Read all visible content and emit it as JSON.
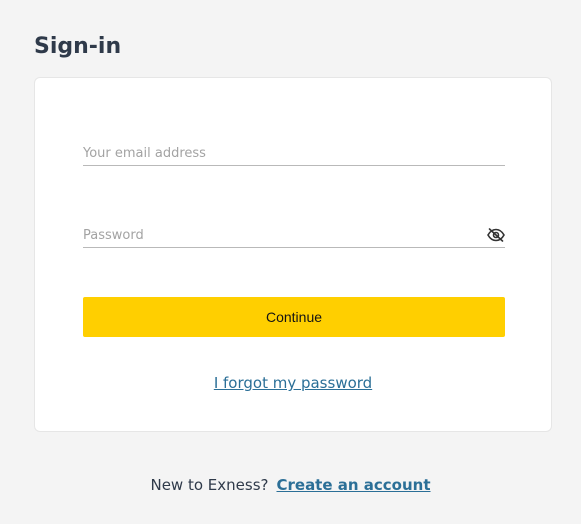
{
  "page": {
    "title": "Sign-in"
  },
  "form": {
    "email": {
      "value": "",
      "placeholder": "Your email address"
    },
    "password": {
      "value": "",
      "placeholder": "Password",
      "toggle_icon": "eye-off-icon"
    },
    "continue_label": "Continue",
    "forgot_label": "I forgot my password"
  },
  "footer": {
    "prompt": "New to Exness?",
    "link_label": "Create an account"
  },
  "colors": {
    "accent": "#ffcf00",
    "link": "#2b6f97",
    "background": "#f4f4f4",
    "text": "#2f3a4a"
  }
}
